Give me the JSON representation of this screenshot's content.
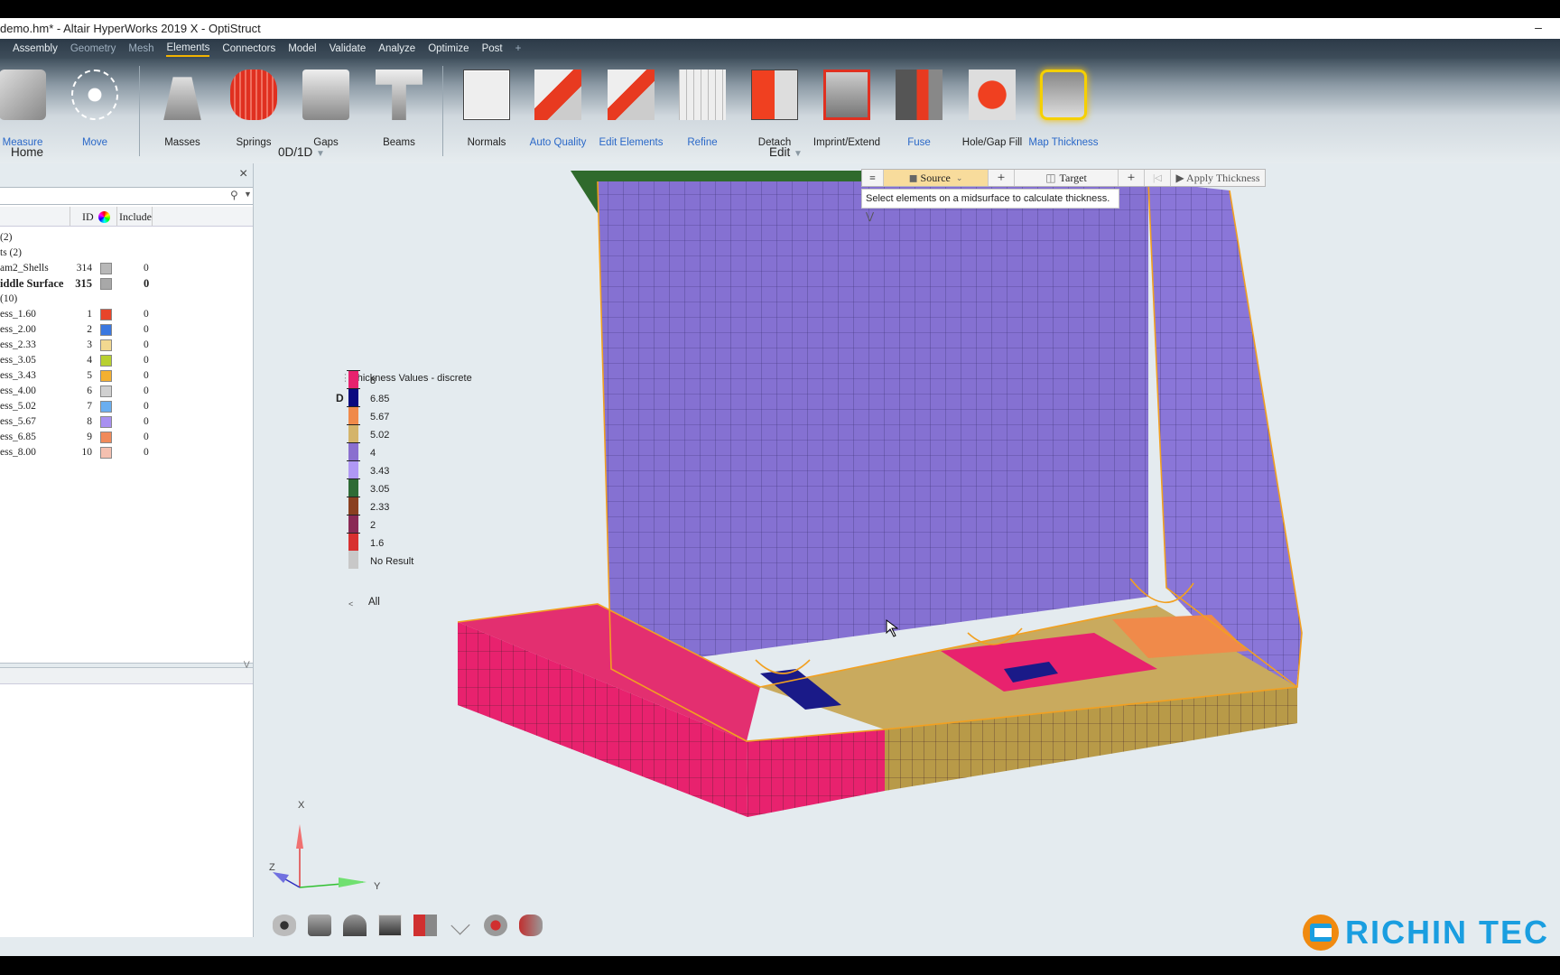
{
  "window": {
    "title": "demo.hm* - Altair HyperWorks 2019 X - OptiStruct",
    "minimize": "–"
  },
  "menu": [
    {
      "label": "Assembly"
    },
    {
      "label": "Geometry"
    },
    {
      "label": "Mesh"
    },
    {
      "label": "Elements",
      "active": true
    },
    {
      "label": "Connectors"
    },
    {
      "label": "Model"
    },
    {
      "label": "Validate"
    },
    {
      "label": "Analyze"
    },
    {
      "label": "Optimize"
    },
    {
      "label": "Post"
    }
  ],
  "menu_add": "+",
  "ribbon": {
    "tools": [
      {
        "label": "Measure",
        "icon": "measure-icon"
      },
      {
        "label": "Move",
        "icon": "move-icon"
      },
      {
        "label": "Masses",
        "icon": "masses-icon"
      },
      {
        "label": "Springs",
        "icon": "springs-icon"
      },
      {
        "label": "Gaps",
        "icon": "gaps-icon"
      },
      {
        "label": "Beams",
        "icon": "beams-icon"
      },
      {
        "label": "Normals",
        "icon": "normals-icon"
      },
      {
        "label": "Auto Quality",
        "icon": "auto-quality-icon"
      },
      {
        "label": "Edit Elements",
        "icon": "edit-elements-icon"
      },
      {
        "label": "Refine",
        "icon": "refine-icon"
      },
      {
        "label": "Detach",
        "icon": "detach-icon"
      },
      {
        "label": "Imprint/Extend",
        "icon": "imprint-extend-icon"
      },
      {
        "label": "Fuse",
        "icon": "fuse-icon"
      },
      {
        "label": "Hole/Gap Fill",
        "icon": "hole-gap-fill-icon"
      },
      {
        "label": "Map Thickness",
        "icon": "map-thickness-icon"
      }
    ],
    "groups": {
      "home": "Home",
      "zerod": "0D/1D",
      "edit": "Edit"
    }
  },
  "panel": {
    "close": "×",
    "columns": {
      "id": "ID",
      "include": "Include"
    },
    "rows": [
      {
        "name": "(2)"
      },
      {
        "name": "ts (2)"
      },
      {
        "name": "am2_Shells",
        "id": "314",
        "color": "#b8b8b8",
        "include": "0"
      },
      {
        "name": "iddle Surface",
        "id": "315",
        "color": "#a8a8a8",
        "include": "0",
        "bold": true
      },
      {
        "name": "(10)"
      },
      {
        "name": "ess_1.60",
        "id": "1",
        "color": "#e8452a",
        "include": "0"
      },
      {
        "name": "ess_2.00",
        "id": "2",
        "color": "#3a78e0",
        "include": "0"
      },
      {
        "name": "ess_2.33",
        "id": "3",
        "color": "#f2d890",
        "include": "0"
      },
      {
        "name": "ess_3.05",
        "id": "4",
        "color": "#b8d030",
        "include": "0"
      },
      {
        "name": "ess_3.43",
        "id": "5",
        "color": "#f4b030",
        "include": "0"
      },
      {
        "name": "ess_4.00",
        "id": "6",
        "color": "#d0d0d0",
        "include": "0"
      },
      {
        "name": "ess_5.02",
        "id": "7",
        "color": "#6aaef0",
        "include": "0"
      },
      {
        "name": "ess_5.67",
        "id": "8",
        "color": "#a890f0",
        "include": "0"
      },
      {
        "name": "ess_6.85",
        "id": "9",
        "color": "#f08a5a",
        "include": "0"
      },
      {
        "name": "ess_8.00",
        "id": "10",
        "color": "#f4c0b0",
        "include": "0"
      }
    ]
  },
  "viewport_toolbar": {
    "menu": "≡",
    "source": "Source",
    "add1": "+",
    "target": "Target",
    "add2": "+",
    "first": "|◁",
    "apply": "▶ Apply Thickness",
    "hint": "Select elements on a midsurface to calculate thickness."
  },
  "legend": {
    "title": "Thickness Values - discrete",
    "mode": "D",
    "items": [
      {
        "label": "8",
        "color": "#e8226e"
      },
      {
        "label": "6.85",
        "color": "#0a0a80"
      },
      {
        "label": "5.67",
        "color": "#f08a4a"
      },
      {
        "label": "5.02",
        "color": "#d4b46a"
      },
      {
        "label": "4",
        "color": "#8a6fcf"
      },
      {
        "label": "3.43",
        "color": "#b098f5"
      },
      {
        "label": "3.05",
        "color": "#2e6b35"
      },
      {
        "label": "2.33",
        "color": "#8a4020"
      },
      {
        "label": "2",
        "color": "#8a2a55"
      },
      {
        "label": "1.6",
        "color": "#d83030"
      },
      {
        "label": "No Result",
        "color": "#c8c8c8"
      }
    ],
    "all": "All",
    "collapse": "<"
  },
  "triad": {
    "x": "X",
    "y": "Y",
    "z": "Z"
  },
  "view_icons": [
    "visualization-eye-icon",
    "camera-icon",
    "surface-icon",
    "cube-view-icon",
    "split-view-icon",
    "triad-icon",
    "zoom-icon",
    "3d-view-icon"
  ],
  "logo": "RICHIN TEC"
}
